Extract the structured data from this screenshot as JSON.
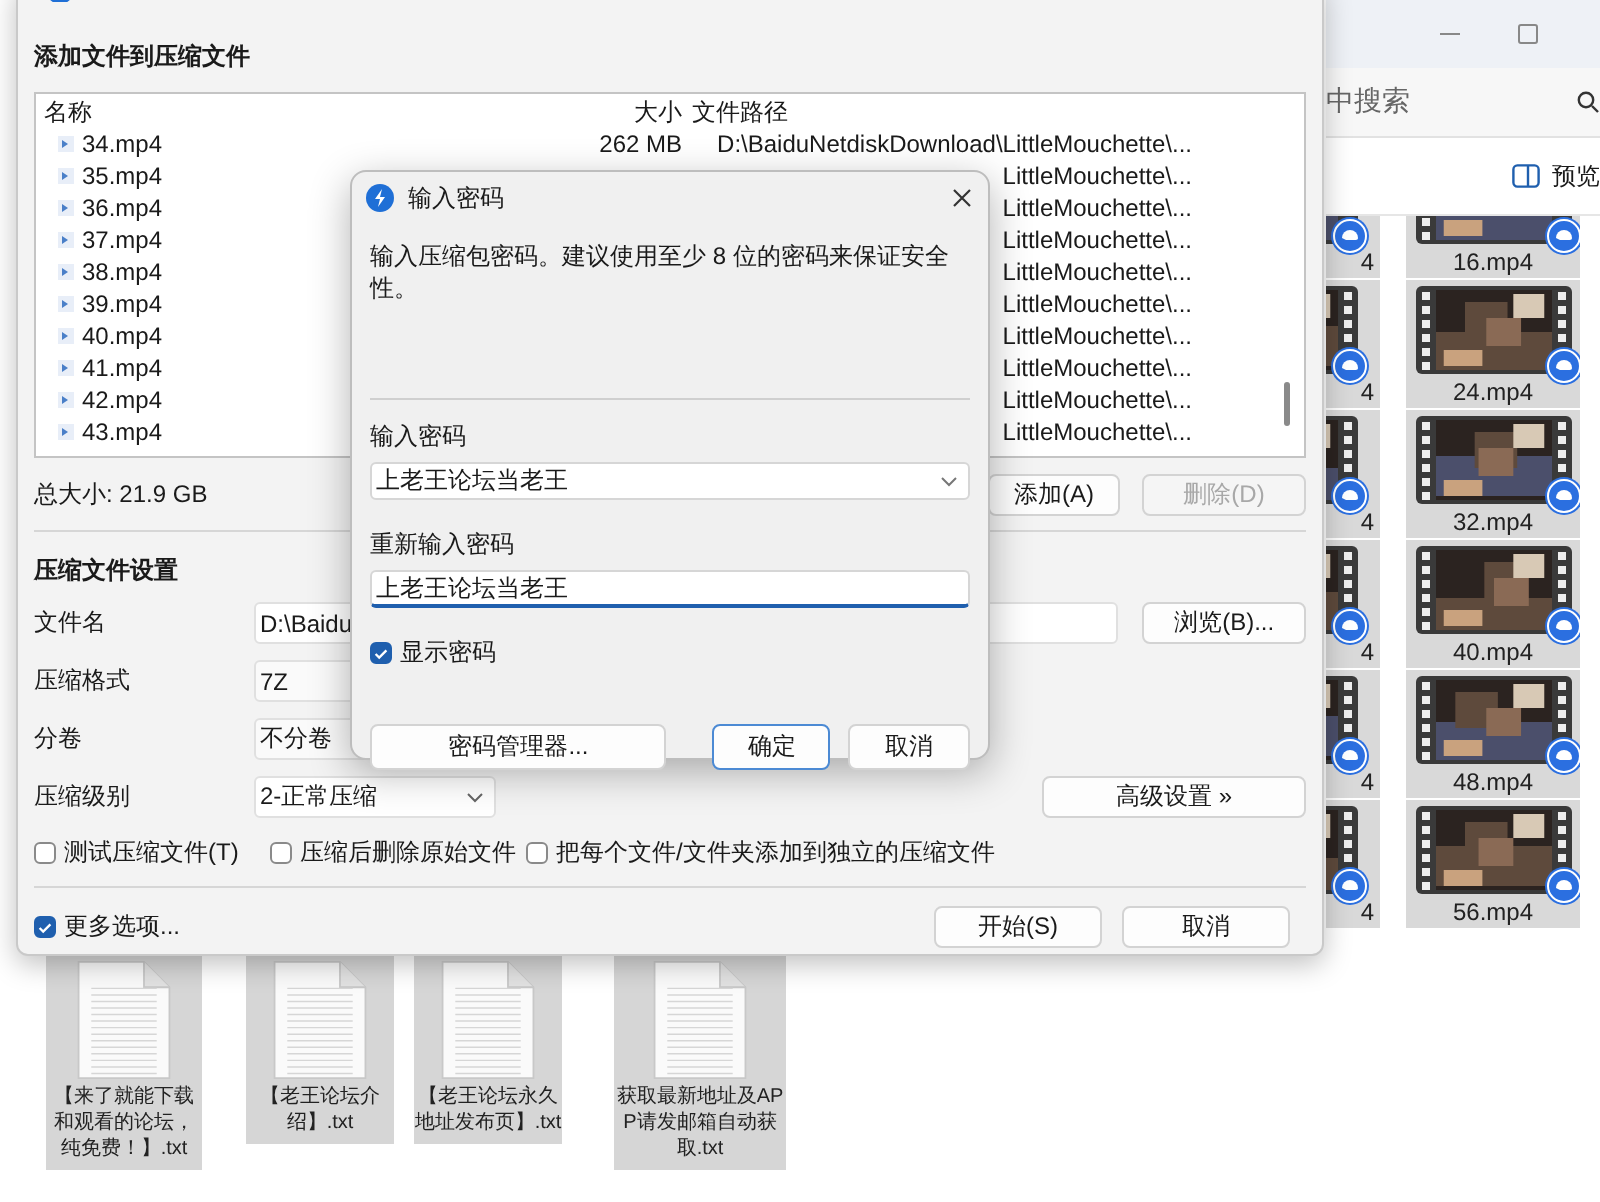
{
  "explorer": {
    "search": {
      "placeholder": "中搜索"
    },
    "preview_button": "预览",
    "partial_tiles": [
      {
        "label": "4"
      },
      {
        "label": "4"
      },
      {
        "label": "4"
      },
      {
        "label": "4"
      },
      {
        "label": "4"
      },
      {
        "label": "4"
      }
    ],
    "tiles": [
      {
        "label": "16.mp4"
      },
      {
        "label": "24.mp4"
      },
      {
        "label": "32.mp4"
      },
      {
        "label": "40.mp4"
      },
      {
        "label": "48.mp4"
      },
      {
        "label": "56.mp4"
      }
    ],
    "text_files": [
      {
        "label": "【来了就能下载和观看的论坛，纯免费！】.txt"
      },
      {
        "label": "【老王论坛介绍】.txt"
      },
      {
        "label": "【老王论坛永久地址发布页】.txt"
      },
      {
        "label": "获取最新地址及APP请发邮箱自动获取.txt"
      }
    ]
  },
  "compress_dialog": {
    "heading": "添加文件到压缩文件",
    "columns": [
      "名称",
      "大小",
      "文件路径"
    ],
    "rows": [
      {
        "name": "34.mp4",
        "size": "262 MB",
        "path": "D:\\BaiduNetdiskDownload\\LittleMouchette\\..."
      },
      {
        "name": "35.mp4",
        "path": "LittleMouchette\\..."
      },
      {
        "name": "36.mp4",
        "path": "LittleMouchette\\..."
      },
      {
        "name": "37.mp4",
        "path": "LittleMouchette\\..."
      },
      {
        "name": "38.mp4",
        "path": "LittleMouchette\\..."
      },
      {
        "name": "39.mp4",
        "path": "LittleMouchette\\..."
      },
      {
        "name": "40.mp4",
        "path": "LittleMouchette\\..."
      },
      {
        "name": "41.mp4",
        "path": "LittleMouchette\\..."
      },
      {
        "name": "42.mp4",
        "path": "LittleMouchette\\..."
      },
      {
        "name": "43.mp4",
        "path": "LittleMouchette\\..."
      }
    ],
    "total": "总大小: 21.9 GB",
    "list_buttons": [
      {
        "label": "添加(A)",
        "disabled": false
      },
      {
        "label": "删除(D)",
        "disabled": true
      }
    ],
    "settings_heading": "压缩文件设置",
    "fields": [
      {
        "label": "文件名",
        "value": "D:\\Baidu",
        "kind": "text",
        "button": "浏览(B)..."
      },
      {
        "label": "压缩格式",
        "value": "7Z",
        "kind": "select"
      },
      {
        "label": "分卷",
        "value": "不分卷",
        "kind": "select"
      },
      {
        "label": "压缩级别",
        "value": "2-正常压缩",
        "kind": "dropdown",
        "button": "高级设置 »"
      }
    ],
    "options": [
      {
        "label": "测试压缩文件(T)",
        "checked": false
      },
      {
        "label": "压缩后删除原始文件",
        "checked": false
      },
      {
        "label": "把每个文件/文件夹添加到独立的压缩文件",
        "checked": false
      }
    ],
    "more_options": {
      "label": "更多选项...",
      "checked": true
    },
    "buttons": [
      {
        "label": "开始(S)"
      },
      {
        "label": "取消"
      }
    ]
  },
  "password_dialog": {
    "title": "输入密码",
    "description": "输入压缩包密码。建议使用至少 8 位的密码来保证安全性。",
    "password": {
      "label": "输入密码",
      "value": "上老王论坛当老王"
    },
    "confirm": {
      "label": "重新输入密码",
      "value": "上老王论坛当老王"
    },
    "show_password": {
      "label": "显示密码",
      "checked": true
    },
    "buttons": [
      {
        "label": "密码管理器...",
        "default": false
      },
      {
        "label": "确定",
        "default": true
      },
      {
        "label": "取消",
        "default": false
      }
    ]
  }
}
